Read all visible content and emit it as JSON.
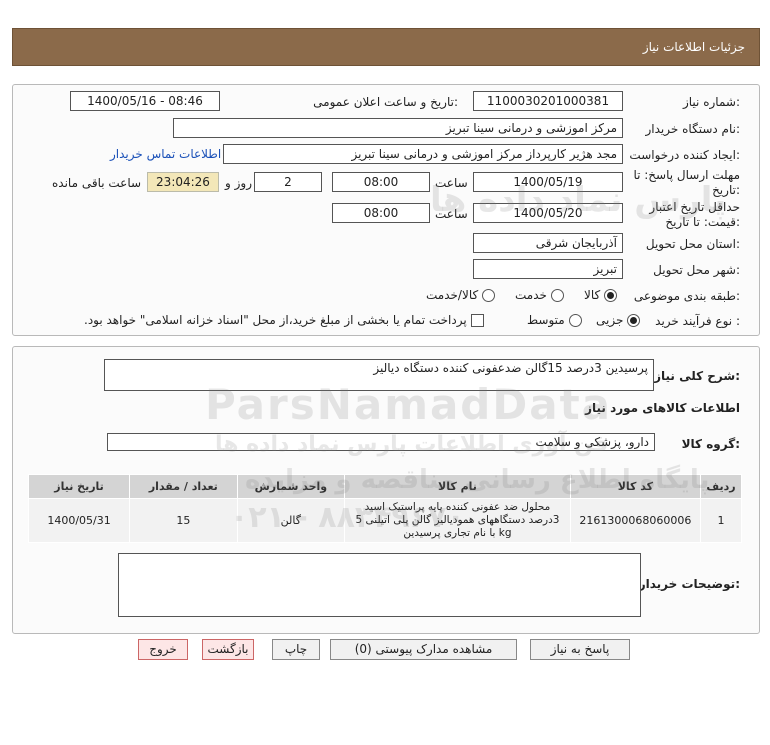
{
  "header": {
    "title": "جزئیات اطلاعات نیاز"
  },
  "fields": {
    "need_number_label": "شماره نیاز:",
    "need_number": "1100030201000381",
    "announce_label": "تاریخ و ساعت اعلان عمومی:",
    "announce_value": "1400/05/16 - 08:46",
    "buyer_org_label": "نام دستگاه خریدار:",
    "buyer_org": "مرکز اموزشی و درمانی سینا تبریز",
    "creator_label": "ایجاد کننده درخواست:",
    "creator": "مجد هژیر کارپرداز مرکز اموزشی و درمانی سینا تبریز",
    "contact_link": "اطلاعات تماس خریدار",
    "deadline_label_1": "مهلت ارسال پاسخ: تا",
    "deadline_label_2": "تاریخ:",
    "deadline_date": "1400/05/19",
    "time_label": "ساعت",
    "deadline_time": "08:00",
    "days_value": "2",
    "days_label": "روز و",
    "remaining_time": "23:04:26",
    "remaining_label": "ساعت باقی مانده",
    "validity_label_1": "حداقل تاریخ اعتبار",
    "validity_label_2": "قیمت: تا تاریخ:",
    "validity_date": "1400/05/20",
    "validity_time": "08:00",
    "province_label": "استان محل تحویل:",
    "province": "آذربایجان شرقی",
    "city_label": "شهر محل تحویل:",
    "city": "تبریز",
    "category_label": "طبقه بندی موضوعی:",
    "category_options": [
      "کالا",
      "خدمت",
      "کالا/خدمت"
    ],
    "process_label": "نوع فرآیند خرید :",
    "process_options": [
      "جزیی",
      "متوسط"
    ],
    "payment_note": "پرداخت تمام یا بخشی از مبلغ خرید،از محل \"اسناد خزانه اسلامی\" خواهد بود."
  },
  "summary": {
    "label": "شرح کلی نیاز:",
    "value": "پرسیدین 3درصد 15گالن ضدعفونی کننده دستگاه دیالیز",
    "goods_info_title": "اطلاعات کالاهای مورد نیاز",
    "goods_group_label": "گروه کالا:",
    "goods_group": "دارو، پزشکی و سلامت"
  },
  "table": {
    "headers": [
      "ردیف",
      "کد کالا",
      "نام کالا",
      "واحد شمارش",
      "تعداد / مقدار",
      "تاریخ نیاز"
    ],
    "rows": [
      {
        "row": "1",
        "code": "2161300068060006",
        "name": "محلول ضد عفونی کننده پایه پراستیک اسید 3درصد دستگاههای همودیالیز گالن پلی اتیلنی 5 kg با نام تجاری پرسیدین",
        "unit": "گالن",
        "qty": "15",
        "date": "1400/05/31"
      }
    ]
  },
  "buyer_notes": {
    "label": "توضیحات خریدار:",
    "value": ""
  },
  "buttons": {
    "reply": "پاسخ به نیاز",
    "docs": "مشاهده مدارک پیوستی (0)",
    "print": "چاپ",
    "back": "بازگشت",
    "exit": "خروج"
  },
  "watermark": {
    "brand": "ParsNamadData",
    "line1": "پارس نماد داده ها",
    "line2": "فن آوری اطلاعات پارس نماد داده ها",
    "line3": "پایگاه اطلاع رسانی مناقصه و مزایده",
    "phone": "۰۲۱ - ۸۸۳۴۹۶۷۰"
  }
}
